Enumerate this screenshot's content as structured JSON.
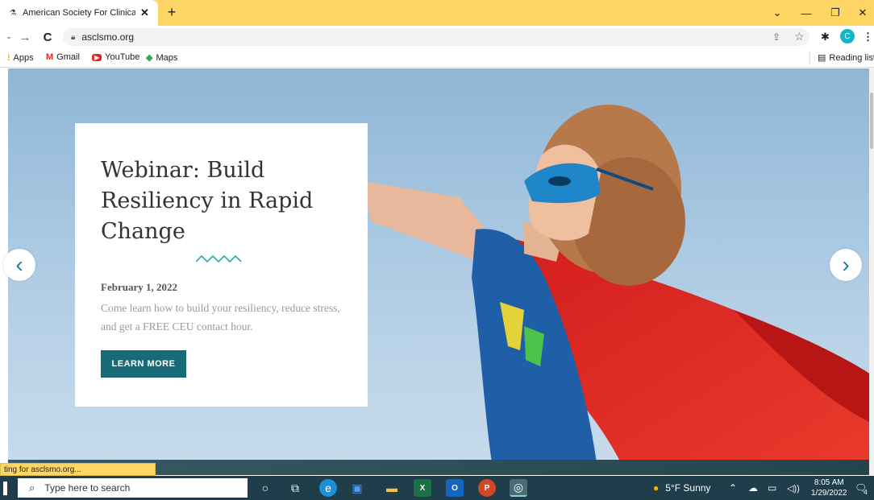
{
  "browser": {
    "tab_title": "American Society For Clinical Lab",
    "tab_close": "✕",
    "new_tab": "+",
    "window_controls": {
      "menu": "⌄",
      "minimize": "—",
      "restore": "❐",
      "close": "✕"
    },
    "url": "asclsmo.org",
    "bookmarks": [
      {
        "label": "Apps",
        "icon": "apps-icon"
      },
      {
        "label": "Gmail",
        "icon": "gmail-icon"
      },
      {
        "label": "YouTube",
        "icon": "youtube-icon"
      },
      {
        "label": "Maps",
        "icon": "maps-icon"
      }
    ],
    "reading_list": "Reading list",
    "profile_initial": "C",
    "status_text": "ting for asclsmo.org..."
  },
  "hero": {
    "title": "Webinar: Build Resiliency in Rapid Change",
    "date": "February 1, 2022",
    "description": "Come learn how to build your resiliency, reduce stress, and get a FREE CEU contact hour.",
    "cta_label": "LEARN MORE",
    "prev_arrow": "‹",
    "next_arrow": "›",
    "accent_color": "#176b78"
  },
  "taskbar": {
    "search_placeholder": "Type here to search",
    "weather": "5°F  Sunny",
    "time": "8:05 AM",
    "date": "1/29/2022",
    "notification_count": "4"
  }
}
